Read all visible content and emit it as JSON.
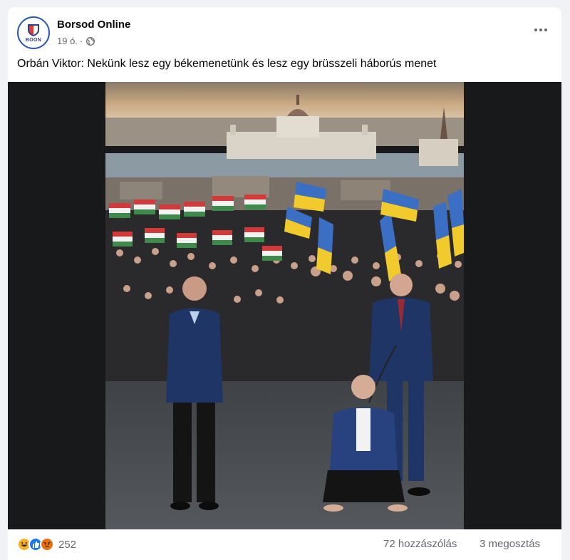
{
  "post": {
    "page_name": "Borsod Online",
    "avatar_text": "BOON",
    "timestamp": "19 ó.",
    "separator": "·",
    "privacy_icon": "globe-icon",
    "more_icon": "more-horizontal-icon",
    "text": "Orbán Viktor: Nekünk lesz egy békemenetünk és lesz egy brüsszeli háborús menet"
  },
  "footer": {
    "reaction_icons": [
      "haha-icon",
      "like-icon",
      "angry-icon"
    ],
    "reaction_count": "252",
    "comments": "72 hozzászólás",
    "shares": "3 megosztás"
  },
  "colors": {
    "background": "#f0f2f5",
    "card": "#ffffff",
    "secondary_text": "#65676b",
    "like_blue": "#1877f2",
    "haha_yellow": "#f7b125",
    "angry_orange": "#e9710f"
  }
}
